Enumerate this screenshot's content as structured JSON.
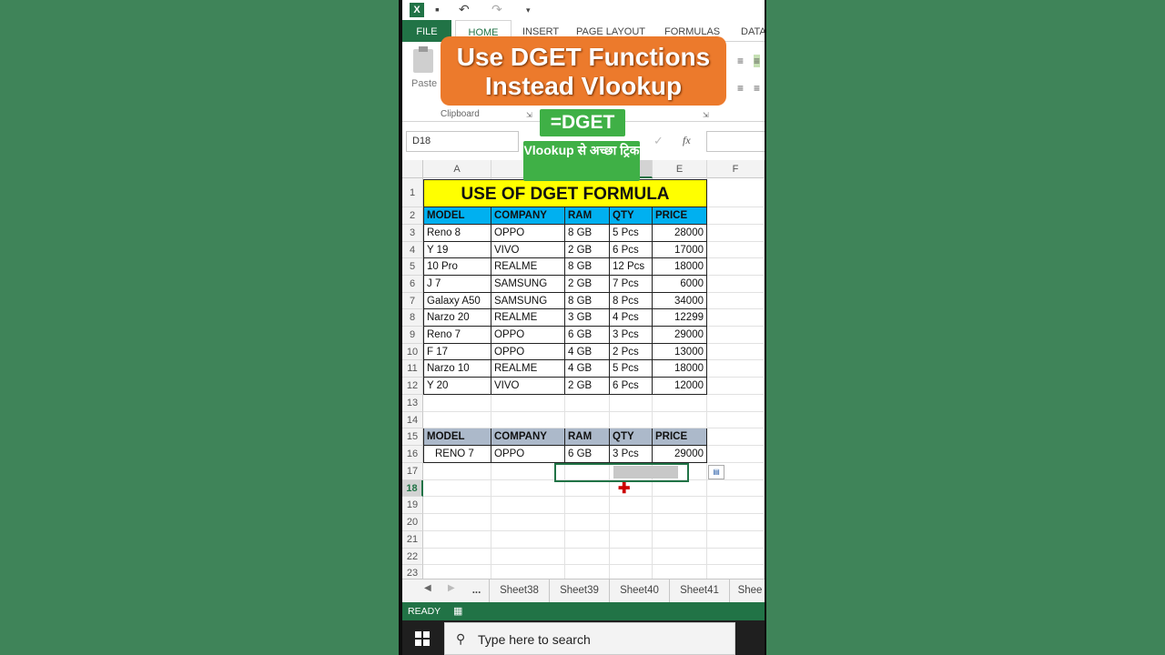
{
  "window": {
    "tabs": [
      "FILE",
      "HOME",
      "INSERT",
      "PAGE LAYOUT",
      "FORMULAS",
      "DATA"
    ],
    "active_tab": "HOME",
    "paste_label": "Paste",
    "clipboard_label": "Clipboard"
  },
  "formula_bar": {
    "name_box": "D18",
    "fx": "fx",
    "cancel": "✕",
    "enter": "✓"
  },
  "grid": {
    "columns": [
      "A",
      "B",
      "C",
      "D",
      "E",
      "F"
    ],
    "selected_column": "D",
    "rows": [
      "1",
      "2",
      "3",
      "4",
      "5",
      "6",
      "7",
      "8",
      "9",
      "10",
      "11",
      "12",
      "13",
      "14",
      "15",
      "16",
      "17",
      "18",
      "19",
      "20",
      "21",
      "22",
      "23"
    ],
    "selected_row": "18",
    "title": "USE OF DGET FORMULA",
    "headers": [
      "MODEL",
      "COMPANY",
      "RAM",
      "QTY",
      "PRICE"
    ],
    "data": [
      [
        "Reno 8",
        "OPPO",
        "8 GB",
        "5 Pcs",
        "28000"
      ],
      [
        "Y 19",
        "VIVO",
        "2 GB",
        "6 Pcs",
        "17000"
      ],
      [
        "10 Pro",
        "REALME",
        "8 GB",
        "12 Pcs",
        "18000"
      ],
      [
        "J 7",
        "SAMSUNG",
        "2 GB",
        "7 Pcs",
        "6000"
      ],
      [
        "Galaxy A50",
        "SAMSUNG",
        "8 GB",
        "8 Pcs",
        "34000"
      ],
      [
        "Narzo 20",
        "REALME",
        "3 GB",
        "4 Pcs",
        "12299"
      ],
      [
        "Reno 7",
        "OPPO",
        "6 GB",
        "3 Pcs",
        "29000"
      ],
      [
        "F 17",
        "OPPO",
        "4 GB",
        "2 Pcs",
        "13000"
      ],
      [
        "Narzo 10",
        "REALME",
        "4 GB",
        "5 Pcs",
        "18000"
      ],
      [
        "Y 20",
        "VIVO",
        "2 GB",
        "6 Pcs",
        "12000"
      ]
    ],
    "lookup_headers": [
      "MODEL",
      "COMPANY",
      "RAM",
      "QTY",
      "PRICE"
    ],
    "lookup_row": [
      "RENO 7",
      "OPPO",
      "6 GB",
      "3 Pcs",
      "29000"
    ]
  },
  "sheets": {
    "more": "...",
    "tabs": [
      "Sheet38",
      "Sheet39",
      "Sheet40",
      "Sheet41",
      "Shee"
    ]
  },
  "status": {
    "text": "READY"
  },
  "taskbar": {
    "search_placeholder": "Type here to search"
  },
  "overlay": {
    "banner": "Use DGET Functions Instead Vlookup",
    "dget": "=DGET",
    "hint": "Vlookup से अच्छा ट्रिक"
  },
  "colors": {
    "excel_green": "#217346",
    "title_fill": "#ffff00",
    "header_fill": "#00b0f0",
    "lookup_header_fill": "#acb9ca",
    "banner": "#ec7a2c",
    "tag": "#3fb046"
  }
}
